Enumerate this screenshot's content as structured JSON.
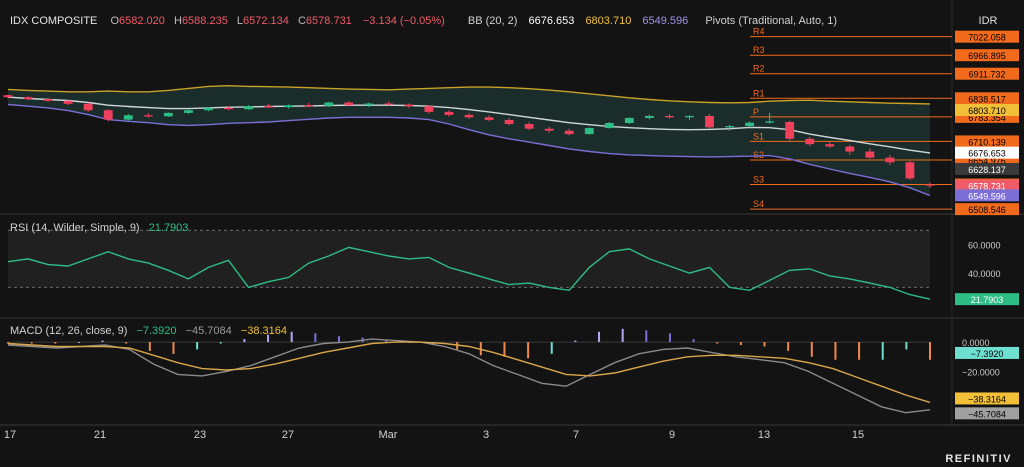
{
  "header": {
    "symbol": "IDX COMPOSITE",
    "ohlc": [
      {
        "k": "O",
        "v": "6582.020"
      },
      {
        "k": "H",
        "v": "6588.235"
      },
      {
        "k": "L",
        "v": "6572.134"
      },
      {
        "k": "C",
        "v": "6578.731"
      }
    ],
    "change": "−3.134 (−0.05%)",
    "bb_label": "BB (20, 2)",
    "bb_mid": "6676.653",
    "bb_upper": "6803.710",
    "bb_lower": "6549.596",
    "pivots_label": "Pivots (Traditional, Auto, 1)",
    "currency": "IDR"
  },
  "rsi_panel": {
    "label": "RSI (14, Wilder, Simple, 9)",
    "value": "21.7903",
    "ticks": [
      "60.0000",
      "40.0000"
    ],
    "value_tag": "21.7903"
  },
  "macd_panel": {
    "label": "MACD (12, 26, close, 9)",
    "macd_value": "−7.3920",
    "signal_value": "−45.7084",
    "hist_value": "−38.3164",
    "ticks": [
      "0.0000",
      "−20.0000"
    ],
    "tags": [
      "−7.3920",
      "−38.3164",
      "−45.7084"
    ]
  },
  "x_axis": {
    "labels": [
      "17",
      "21",
      "23",
      "27",
      "Mar",
      "3",
      "7",
      "9",
      "13",
      "15"
    ]
  },
  "pivot_levels": [
    {
      "name": "R4",
      "value": "7022.058"
    },
    {
      "name": "R3",
      "value": "6966.895"
    },
    {
      "name": "R2",
      "value": "6911.732"
    },
    {
      "name": "R1",
      "value": "6838.517"
    },
    {
      "name": "P",
      "value": "6783.354"
    },
    {
      "name": "S1",
      "value": "6710.139"
    },
    {
      "name": "S2",
      "value": "6654.976"
    },
    {
      "name": "S3",
      "value": "6581.761"
    },
    {
      "name": "S4",
      "value": "6508.546"
    }
  ],
  "price_tags": [
    {
      "value": "6803.710",
      "color": "#f2c037",
      "text_color": "#000000"
    },
    {
      "value": "6676.653",
      "color": "#ffffff",
      "text_color": "#000000"
    },
    {
      "value": "6628.137",
      "color": "#3a3a3a",
      "text_color": "#ffffff"
    },
    {
      "value": "6578.731",
      "color": "#f05b6a",
      "text_color": "#ffffff"
    },
    {
      "value": "6549.596",
      "color": "#7b6fd6",
      "text_color": "#ffffff"
    }
  ],
  "brand": "REFINITIV",
  "colors": {
    "up": "#2ebd85",
    "down": "#f0405c",
    "bb_upper": "#c9a227",
    "bb_lower": "#7b6fd6",
    "bb_mid": "#cfd8d8",
    "pivot": "#f26b1d",
    "rsi": "#2ebd85",
    "macd": "#8a8a8a",
    "signal": "#d9a74a"
  },
  "chart_data": [
    {
      "type": "candlestick",
      "price_range": [
        6500,
        7030
      ],
      "bollinger": {
        "upper": [
          6865,
          6862,
          6860,
          6858,
          6858,
          6860,
          6858,
          6858,
          6862,
          6868,
          6874,
          6876,
          6874,
          6873,
          6872,
          6870,
          6868,
          6866,
          6865,
          6864,
          6866,
          6868,
          6870,
          6872,
          6872,
          6870,
          6867,
          6863,
          6858,
          6852,
          6846,
          6840,
          6835,
          6831,
          6828,
          6826,
          6825,
          6826,
          6830,
          6832,
          6833,
          6830,
          6828,
          6826,
          6824,
          6823,
          6822
        ],
        "middle": [
          6842,
          6838,
          6835,
          6832,
          6826,
          6818,
          6814,
          6811,
          6808,
          6808,
          6810,
          6812,
          6813,
          6814,
          6815,
          6816,
          6817,
          6818,
          6818,
          6818,
          6817,
          6815,
          6811,
          6805,
          6798,
          6790,
          6782,
          6774,
          6766,
          6760,
          6755,
          6751,
          6748,
          6746,
          6745,
          6746,
          6748,
          6752,
          6751,
          6745,
          6732,
          6722,
          6713,
          6703,
          6694,
          6684,
          6676
        ],
        "lower": [
          6820,
          6815,
          6810,
          6802,
          6790,
          6775,
          6770,
          6766,
          6760,
          6758,
          6760,
          6764,
          6766,
          6768,
          6772,
          6776,
          6780,
          6782,
          6782,
          6782,
          6780,
          6775,
          6762,
          6745,
          6730,
          6718,
          6708,
          6698,
          6688,
          6680,
          6674,
          6670,
          6668,
          6666,
          6665,
          6664,
          6665,
          6666,
          6668,
          6658,
          6642,
          6628,
          6615,
          6603,
          6590,
          6572,
          6549
        ]
      },
      "candles": [
        [
          6848,
          6850,
          6838,
          6842
        ],
        [
          6842,
          6845,
          6833,
          6836
        ],
        [
          6836,
          6840,
          6828,
          6831
        ],
        [
          6831,
          6834,
          6818,
          6822
        ],
        [
          6822,
          6826,
          6798,
          6803
        ],
        [
          6803,
          6806,
          6770,
          6775
        ],
        [
          6775,
          6792,
          6772,
          6788
        ],
        [
          6788,
          6794,
          6781,
          6785
        ],
        [
          6785,
          6797,
          6783,
          6795
        ],
        [
          6795,
          6806,
          6792,
          6803
        ],
        [
          6803,
          6812,
          6800,
          6810
        ],
        [
          6810,
          6815,
          6803,
          6806
        ],
        [
          6806,
          6818,
          6804,
          6815
        ],
        [
          6815,
          6822,
          6810,
          6812
        ],
        [
          6812,
          6820,
          6808,
          6818
        ],
        [
          6818,
          6825,
          6812,
          6816
        ],
        [
          6816,
          6828,
          6813,
          6826
        ],
        [
          6826,
          6830,
          6815,
          6818
        ],
        [
          6818,
          6826,
          6812,
          6823
        ],
        [
          6823,
          6830,
          6817,
          6820
        ],
        [
          6820,
          6823,
          6810,
          6815
        ],
        [
          6815,
          6818,
          6793,
          6798
        ],
        [
          6798,
          6803,
          6784,
          6789
        ],
        [
          6789,
          6795,
          6778,
          6782
        ],
        [
          6782,
          6788,
          6770,
          6774
        ],
        [
          6774,
          6780,
          6758,
          6762
        ],
        [
          6762,
          6768,
          6744,
          6748
        ],
        [
          6748,
          6754,
          6735,
          6742
        ],
        [
          6742,
          6748,
          6728,
          6732
        ],
        [
          6732,
          6752,
          6730,
          6750
        ],
        [
          6750,
          6768,
          6748,
          6765
        ],
        [
          6765,
          6782,
          6762,
          6780
        ],
        [
          6780,
          6790,
          6775,
          6786
        ],
        [
          6786,
          6792,
          6778,
          6782
        ],
        [
          6782,
          6788,
          6774,
          6786
        ],
        [
          6786,
          6792,
          6748,
          6752
        ],
        [
          6752,
          6760,
          6742,
          6756
        ],
        [
          6756,
          6770,
          6752,
          6766
        ],
        [
          6766,
          6796,
          6763,
          6770
        ],
        [
          6768,
          6772,
          6710,
          6718
        ],
        [
          6718,
          6724,
          6696,
          6702
        ],
        [
          6702,
          6708,
          6690,
          6695
        ],
        [
          6695,
          6700,
          6670,
          6680
        ],
        [
          6680,
          6690,
          6658,
          6662
        ],
        [
          6662,
          6670,
          6640,
          6648
        ],
        [
          6648,
          6652,
          6595,
          6600
        ],
        [
          6582,
          6588,
          6572,
          6579
        ]
      ]
    },
    {
      "type": "line",
      "name": "RSI (14, Wilder, Simple, 9)",
      "y_range": [
        10,
        80
      ],
      "levels": [
        70,
        30
      ],
      "values": [
        48,
        50,
        46,
        45,
        50,
        55,
        50,
        47,
        42,
        36,
        44,
        49,
        30,
        34,
        37,
        47,
        52,
        58,
        55,
        52,
        50,
        51,
        44,
        40,
        36,
        32,
        33,
        30,
        28,
        44,
        55,
        57,
        50,
        45,
        40,
        44,
        30,
        28,
        35,
        42,
        43,
        38,
        36,
        33,
        30,
        25,
        21.79
      ]
    },
    {
      "type": "bar+line",
      "name": "MACD (12, 26, close, 9)",
      "y_range": [
        -55,
        15
      ],
      "macd": [
        -2,
        -3,
        -4,
        -3,
        -2,
        -5,
        -15,
        -22,
        -23,
        -20,
        -16,
        -10,
        -4,
        -1,
        0,
        2,
        1,
        0,
        -3,
        -8,
        -16,
        -22,
        -28,
        -30,
        -22,
        -14,
        -8,
        -5,
        -4,
        -7,
        -10,
        -12,
        -14,
        -20,
        -28,
        -36,
        -44,
        -48,
        -46,
        -7.39
      ],
      "signal": [
        -1,
        -2,
        -3,
        -3,
        -3,
        -4,
        -9,
        -14,
        -18,
        -19,
        -18,
        -15,
        -11,
        -7,
        -4,
        -1,
        0,
        0,
        -1,
        -3,
        -7,
        -12,
        -17,
        -22,
        -23,
        -21,
        -17,
        -13,
        -10,
        -9,
        -9,
        -10,
        -11,
        -14,
        -18,
        -24,
        -30,
        -36,
        -41,
        -45.71
      ],
      "histogram": [
        -1,
        -1,
        -1,
        0,
        1,
        -1,
        -6,
        -8,
        -5,
        -1,
        2,
        5,
        7,
        6,
        4,
        3,
        1,
        0,
        -2,
        -5,
        -9,
        -10,
        -11,
        -8,
        1,
        7,
        9,
        8,
        6,
        2,
        -1,
        -2,
        -3,
        -6,
        -10,
        -12,
        -14,
        -12,
        -5,
        -38.32
      ]
    }
  ]
}
